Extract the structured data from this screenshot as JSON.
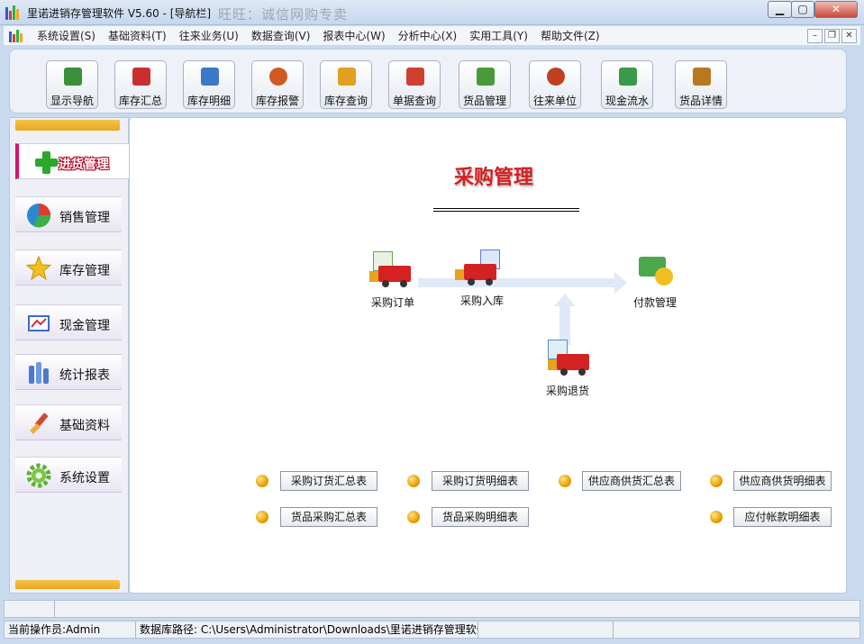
{
  "window": {
    "title": "里诺进销存管理软件 V5.60 - [导航栏]",
    "watermark": "旺旺：诚信网购专卖",
    "min_label": "▁",
    "max_label": "▢",
    "close_label": "✕"
  },
  "menu": {
    "items": [
      "系统设置(S)",
      "基础资料(T)",
      "往来业务(U)",
      "数据查询(V)",
      "报表中心(W)",
      "分析中心(X)",
      "实用工具(Y)",
      "帮助文件(Z)"
    ],
    "mdi_min": "–",
    "mdi_restore": "❐",
    "mdi_close": "✕"
  },
  "toolbar": {
    "items": [
      {
        "label": "显示导航",
        "icon": "navigation-icon",
        "color": "#3a8f3a"
      },
      {
        "label": "库存汇总",
        "icon": "inventory-summary-icon",
        "color": "#c83030"
      },
      {
        "label": "库存明细",
        "icon": "inventory-detail-icon",
        "color": "#3b78c8"
      },
      {
        "label": "库存报警",
        "icon": "inventory-alarm-icon",
        "color": "#d05a20"
      },
      {
        "label": "库存查询",
        "icon": "inventory-search-icon",
        "color": "#e0a020"
      },
      {
        "label": "单据查询",
        "icon": "document-search-icon",
        "color": "#d04030"
      },
      {
        "label": "货品管理",
        "icon": "goods-management-icon",
        "color": "#4a9a3a"
      },
      {
        "label": "往来单位",
        "icon": "contacts-icon",
        "color": "#c04020"
      },
      {
        "label": "现金流水",
        "icon": "cash-flow-icon",
        "color": "#3a9a4a"
      },
      {
        "label": "货品详情",
        "icon": "goods-detail-icon",
        "color": "#b87820"
      }
    ]
  },
  "leftnav": {
    "items": [
      {
        "label": "进货管理",
        "icon": "plus-icon",
        "color": "#2aa82a",
        "active": true
      },
      {
        "label": "销售管理",
        "icon": "pie-chart-icon",
        "color": "#2a8ad0",
        "active": false
      },
      {
        "label": "库存管理",
        "icon": "star-icon",
        "color": "#f0c020",
        "active": false
      },
      {
        "label": "现金管理",
        "icon": "cash-icon",
        "color": "#3a6ad0",
        "active": false
      },
      {
        "label": "统计报表",
        "icon": "bar-chart-icon",
        "color": "#4a7ad0",
        "active": false
      },
      {
        "label": "基础资料",
        "icon": "brush-icon",
        "color": "#d04a30",
        "active": false
      },
      {
        "label": "系统设置",
        "icon": "gear-icon",
        "color": "#5ab030",
        "active": false
      }
    ]
  },
  "main": {
    "title": "采购管理",
    "flow": {
      "order": "采购订单",
      "stock_in": "采购入库",
      "payment": "付款管理",
      "return": "采购退货"
    },
    "reports": {
      "order_summary": "采购订货汇总表",
      "order_detail": "采购订货明细表",
      "supplier_summary": "供应商供货汇总表",
      "supplier_detail": "供应商供货明细表",
      "goods_summary": "货品采购汇总表",
      "goods_detail": "货品采购明细表",
      "payable_detail": "应付帐款明细表"
    }
  },
  "status": {
    "operator": "当前操作员:Admin",
    "db_path": "数据库路径: C:\\Users\\Administrator\\Downloads\\里诺进销存管理软件"
  }
}
